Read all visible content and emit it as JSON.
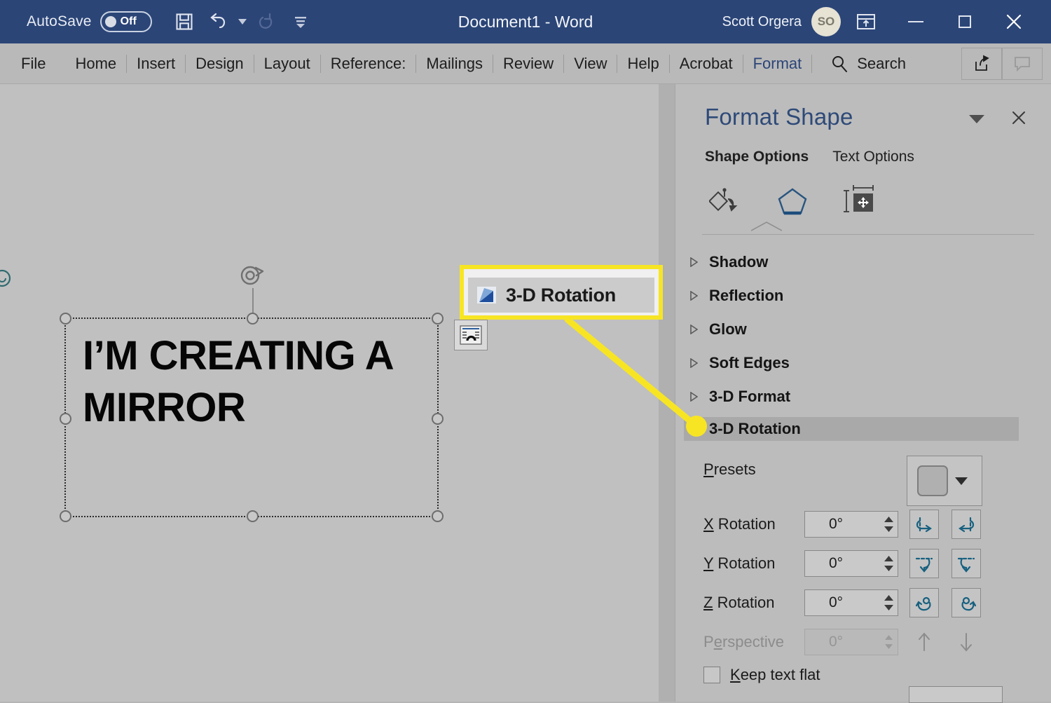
{
  "window": {
    "title": "Document1  -  Word",
    "autosave_label": "AutoSave",
    "autosave_state": "Off",
    "user_name": "Scott Orgera",
    "avatar_initials": "SO",
    "quick_access": [
      {
        "name": "save-icon",
        "label": "Save"
      },
      {
        "name": "undo-icon",
        "label": "Undo"
      },
      {
        "name": "redo-icon",
        "label": "Redo"
      },
      {
        "name": "customize-qat-icon",
        "label": "Customize Quick Access Toolbar"
      }
    ],
    "controls": [
      {
        "name": "ribbon-display-options-icon",
        "label": "Ribbon Display Options"
      },
      {
        "name": "minimize-icon",
        "label": "Minimize"
      },
      {
        "name": "restore-icon",
        "label": "Restore Down"
      },
      {
        "name": "close-icon",
        "label": "Close"
      }
    ],
    "accent_color": "#2b4577"
  },
  "ribbon": {
    "tabs": [
      {
        "label": "File",
        "contextual": false
      },
      {
        "label": "Home",
        "contextual": false
      },
      {
        "label": "Insert",
        "contextual": false
      },
      {
        "label": "Design",
        "contextual": false
      },
      {
        "label": "Layout",
        "contextual": false
      },
      {
        "label": "Reference:",
        "contextual": false
      },
      {
        "label": "Mailings",
        "contextual": false
      },
      {
        "label": "Review",
        "contextual": false
      },
      {
        "label": "View",
        "contextual": false
      },
      {
        "label": "Help",
        "contextual": false
      },
      {
        "label": "Acrobat",
        "contextual": false
      },
      {
        "label": "Format",
        "contextual": true
      }
    ],
    "search_label": "Search",
    "right_buttons": [
      {
        "name": "share-icon",
        "label": "Share"
      },
      {
        "name": "comments-icon",
        "label": "Comments"
      }
    ]
  },
  "document": {
    "shape_text": "I’M CREATING A MIRROR",
    "layout_options_icon": "layout-options-icon",
    "rotate_handle_icon": "rotate-handle-icon"
  },
  "callout": {
    "label": "3-D Rotation",
    "highlight_color": "#f7e524",
    "icon": "3d-rotation-icon"
  },
  "panel": {
    "title": "Format Shape",
    "header_buttons": [
      {
        "name": "panel-options-caret-icon",
        "label": "Task Pane Options"
      },
      {
        "name": "panel-close-icon",
        "label": "Close"
      }
    ],
    "tabs": [
      {
        "label": "Shape Options",
        "active": true
      },
      {
        "label": "Text Options",
        "active": false
      }
    ],
    "category_icons": [
      {
        "name": "fill-and-line-icon",
        "label": "Fill & Line",
        "selected": false
      },
      {
        "name": "effects-icon",
        "label": "Effects",
        "selected": true
      },
      {
        "name": "layout-properties-icon",
        "label": "Layout & Properties",
        "selected": false
      }
    ],
    "sections": [
      {
        "label": "Shadow",
        "expanded": false,
        "selected": false
      },
      {
        "label": "Reflection",
        "expanded": false,
        "selected": false
      },
      {
        "label": "Glow",
        "expanded": false,
        "selected": false
      },
      {
        "label": "Soft Edges",
        "expanded": false,
        "selected": false
      },
      {
        "label": "3-D Format",
        "expanded": false,
        "selected": false
      },
      {
        "label": "3-D Rotation",
        "expanded": true,
        "selected": true
      }
    ],
    "rotation": {
      "presets_label": "Presets",
      "presets_accesskey": "P",
      "fields": [
        {
          "label": "X Rotation",
          "accesskey": "X",
          "value": "0°",
          "disabled": false,
          "buttons": [
            {
              "name": "x-rotate-left-icon",
              "label": "X Rotation Left"
            },
            {
              "name": "x-rotate-right-icon",
              "label": "X Rotation Right"
            }
          ]
        },
        {
          "label": "Y Rotation",
          "accesskey": "Y",
          "value": "0°",
          "disabled": false,
          "buttons": [
            {
              "name": "y-rotate-up-icon",
              "label": "Y Rotation Up"
            },
            {
              "name": "y-rotate-down-icon",
              "label": "Y Rotation Down"
            }
          ]
        },
        {
          "label": "Z Rotation",
          "accesskey": "Z",
          "value": "0°",
          "disabled": false,
          "buttons": [
            {
              "name": "z-rotate-ccw-icon",
              "label": "Z Rotation Counterclockwise"
            },
            {
              "name": "z-rotate-cw-icon",
              "label": "Z Rotation Clockwise"
            }
          ]
        },
        {
          "label": "Perspective",
          "accesskey": "e",
          "value": "0°",
          "disabled": true,
          "buttons": [
            {
              "name": "perspective-narrow-icon",
              "label": "Narrow Perspective"
            },
            {
              "name": "perspective-widen-icon",
              "label": "Widen Perspective"
            }
          ]
        }
      ],
      "keep_text_flat_label": "Keep text flat",
      "keep_text_flat_accesskey": "K",
      "keep_text_flat_checked": false
    }
  }
}
